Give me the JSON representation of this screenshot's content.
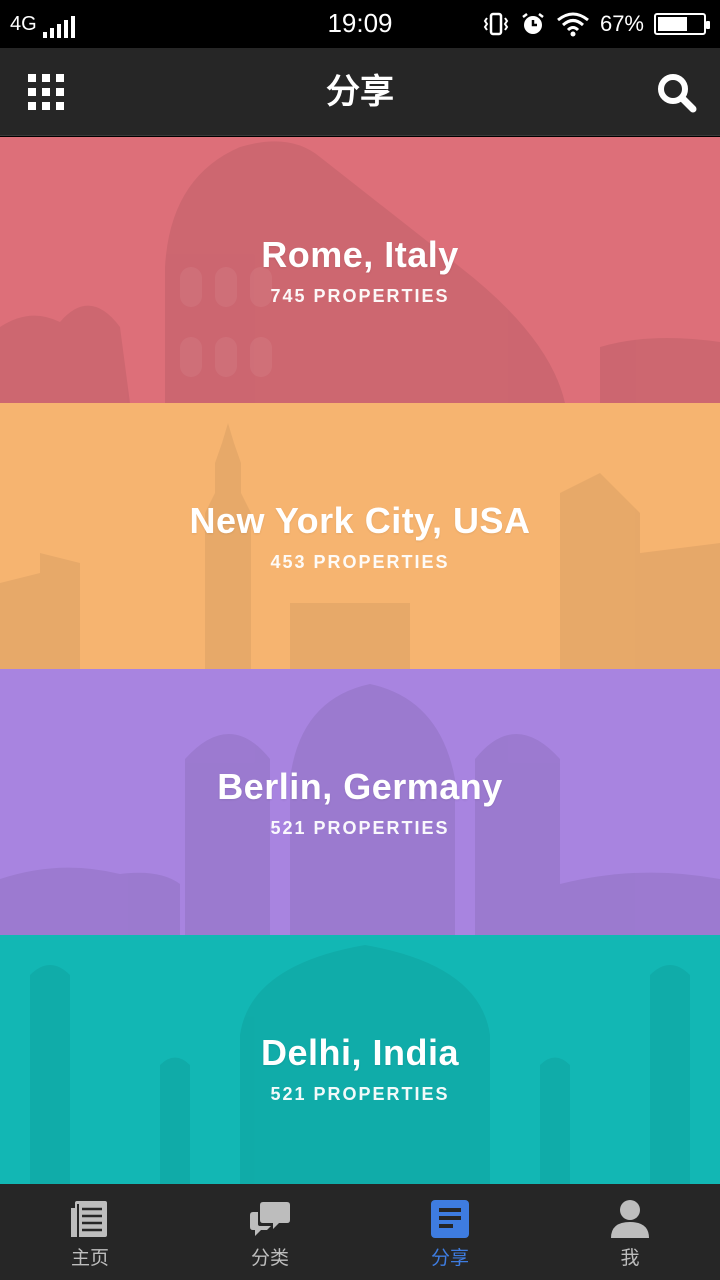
{
  "status_bar": {
    "network": "4G",
    "time": "19:09",
    "battery_percent": "67%",
    "battery_level": 0.67,
    "icons": [
      "signal-icon",
      "vibrate-icon",
      "alarm-icon",
      "wifi-icon",
      "battery-icon"
    ]
  },
  "header": {
    "title": "分享",
    "left_icon": "grid-menu-icon",
    "right_icon": "search-icon"
  },
  "cities": [
    {
      "name": "Rome, Italy",
      "count": "745 PROPERTIES",
      "color": "#dd6f79",
      "landmark": "colosseum"
    },
    {
      "name": "New York City, USA",
      "count": "453 PROPERTIES",
      "color": "#f6b470",
      "landmark": "skyline"
    },
    {
      "name": "Berlin, Germany",
      "count": "521 PROPERTIES",
      "color": "#a884e0",
      "landmark": "cathedral"
    },
    {
      "name": "Delhi, India",
      "count": "521 PROPERTIES",
      "color": "#12b7b4",
      "landmark": "taj-mahal"
    }
  ],
  "bottom_nav": [
    {
      "label": "主页",
      "icon": "news-icon",
      "active": false
    },
    {
      "label": "分类",
      "icon": "chat-icon",
      "active": false
    },
    {
      "label": "分享",
      "icon": "document-icon",
      "active": true
    },
    {
      "label": "我",
      "icon": "user-icon",
      "active": false
    }
  ],
  "colors": {
    "bar_background": "#262626",
    "active_tab": "#3e7ce0",
    "inactive_tab": "#bdbdbd"
  }
}
